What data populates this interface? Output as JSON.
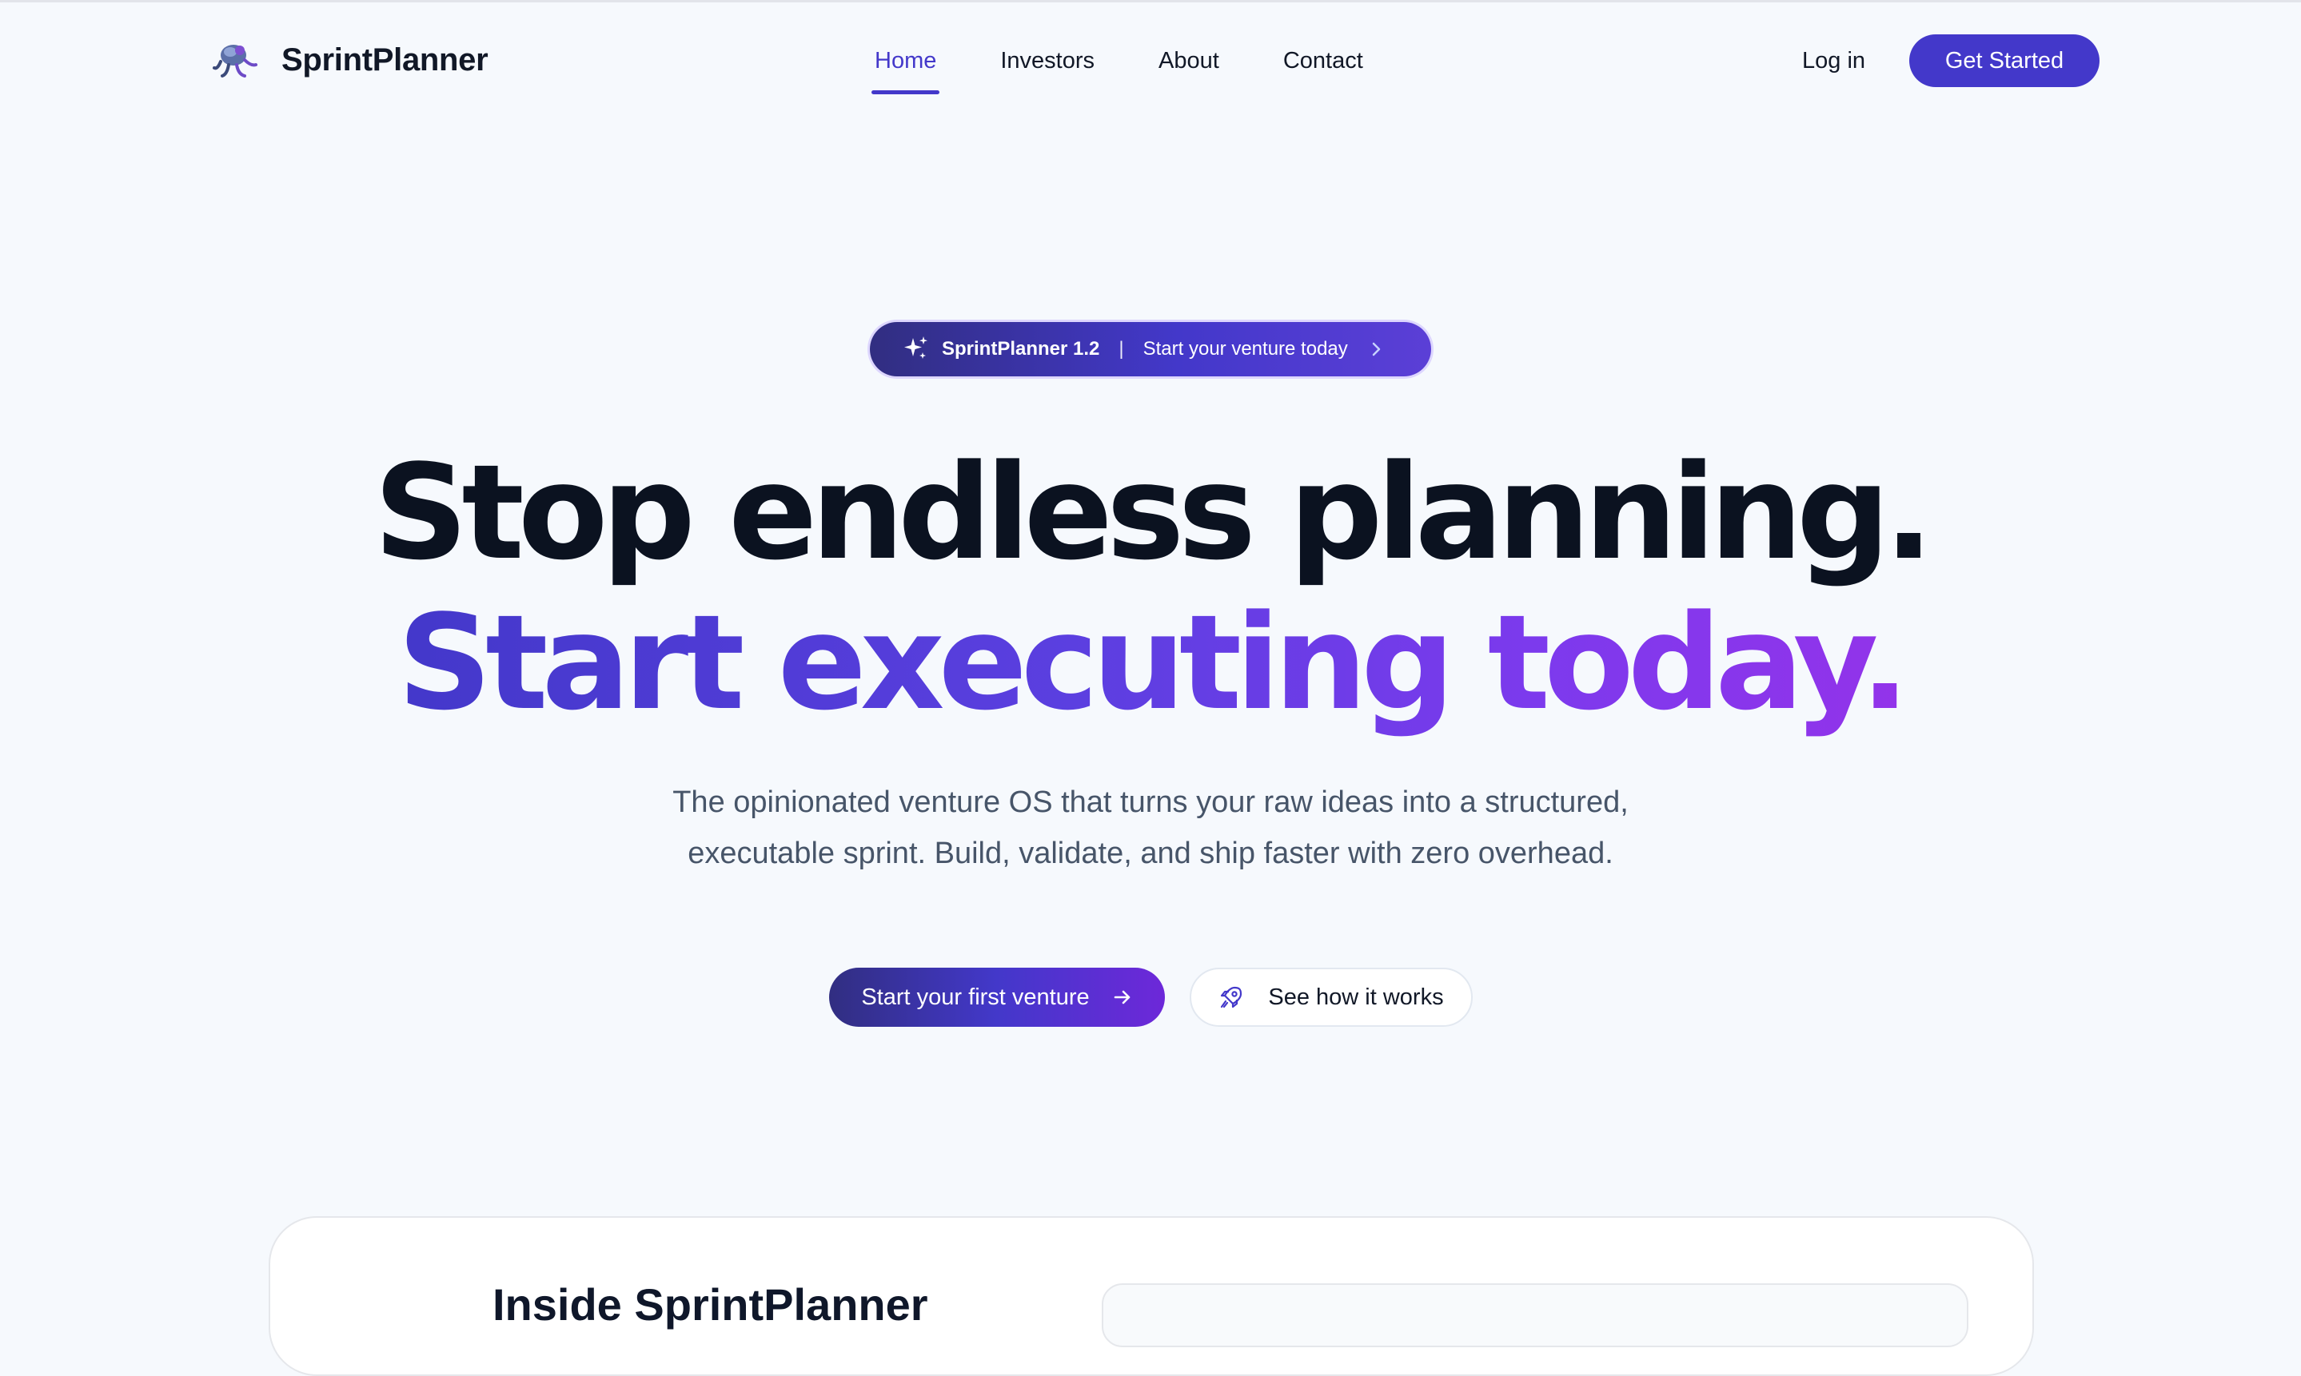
{
  "brand": {
    "name": "SprintPlanner"
  },
  "nav": {
    "links": [
      {
        "label": "Home"
      },
      {
        "label": "Investors"
      },
      {
        "label": "About"
      },
      {
        "label": "Contact"
      }
    ],
    "active": "Home",
    "login_label": "Log in",
    "cta_label": "Get Started"
  },
  "announcement": {
    "version": "SprintPlanner 1.2",
    "separator": "|",
    "text": "Start your venture today",
    "icon": "sparkles-icon"
  },
  "hero": {
    "title_line1": "Stop endless planning.",
    "title_line2": "Start executing today.",
    "subtitle_line1": "The opinionated venture OS that turns your raw ideas into a structured,",
    "subtitle_line2": "executable sprint. Build, validate, and ship faster with zero overhead.",
    "primary_cta": "Start your first venture",
    "secondary_cta": "See how it works"
  },
  "preview": {
    "title": "Inside SprintPlanner"
  },
  "colors": {
    "accent": "#4338ca",
    "gradient_end": "#9333ea",
    "background": "#f6f9fd",
    "heading": "#0b1220",
    "body_text": "#475569"
  },
  "icons": [
    "logo-icon",
    "sparkles-icon",
    "chevron-right-icon",
    "arrow-right-icon",
    "rocket-icon"
  ]
}
